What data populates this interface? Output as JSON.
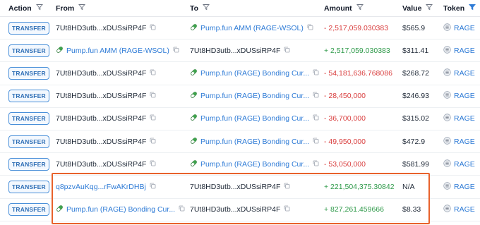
{
  "headers": {
    "action": "Action",
    "from": "From",
    "to": "To",
    "amount": "Amount",
    "value": "Value",
    "token": "Token"
  },
  "rows": [
    {
      "action": "TRANSFER",
      "from": "7Ut8HD3utb...xDUSsiRP4F",
      "from_link": false,
      "from_pill": false,
      "to": "Pump.fun AMM (RAGE-WSOL)",
      "to_link": true,
      "to_pill": true,
      "amount": "- 2,517,059.030383",
      "sign": "neg",
      "value": "$565.9",
      "token": "RAGE"
    },
    {
      "action": "TRANSFER",
      "from": "Pump.fun AMM (RAGE-WSOL)",
      "from_link": true,
      "from_pill": true,
      "to": "7Ut8HD3utb...xDUSsiRP4F",
      "to_link": false,
      "to_pill": false,
      "amount": "+ 2,517,059.030383",
      "sign": "pos",
      "value": "$311.41",
      "token": "RAGE"
    },
    {
      "action": "TRANSFER",
      "from": "7Ut8HD3utb...xDUSsiRP4F",
      "from_link": false,
      "from_pill": false,
      "to": "Pump.fun (RAGE) Bonding Cur...",
      "to_link": true,
      "to_pill": true,
      "amount": "- 54,181,636.768086",
      "sign": "neg",
      "value": "$268.72",
      "token": "RAGE"
    },
    {
      "action": "TRANSFER",
      "from": "7Ut8HD3utb...xDUSsiRP4F",
      "from_link": false,
      "from_pill": false,
      "to": "Pump.fun (RAGE) Bonding Cur...",
      "to_link": true,
      "to_pill": true,
      "amount": "- 28,450,000",
      "sign": "neg",
      "value": "$246.93",
      "token": "RAGE"
    },
    {
      "action": "TRANSFER",
      "from": "7Ut8HD3utb...xDUSsiRP4F",
      "from_link": false,
      "from_pill": false,
      "to": "Pump.fun (RAGE) Bonding Cur...",
      "to_link": true,
      "to_pill": true,
      "amount": "- 36,700,000",
      "sign": "neg",
      "value": "$315.02",
      "token": "RAGE"
    },
    {
      "action": "TRANSFER",
      "from": "7Ut8HD3utb...xDUSsiRP4F",
      "from_link": false,
      "from_pill": false,
      "to": "Pump.fun (RAGE) Bonding Cur...",
      "to_link": true,
      "to_pill": true,
      "amount": "- 49,950,000",
      "sign": "neg",
      "value": "$472.9",
      "token": "RAGE"
    },
    {
      "action": "TRANSFER",
      "from": "7Ut8HD3utb...xDUSsiRP4F",
      "from_link": false,
      "from_pill": false,
      "to": "Pump.fun (RAGE) Bonding Cur...",
      "to_link": true,
      "to_pill": true,
      "amount": "- 53,050,000",
      "sign": "neg",
      "value": "$581.99",
      "token": "RAGE"
    },
    {
      "action": "TRANSFER",
      "from": "q8pzvAuKqg...rFwAKrDHBj",
      "from_link": true,
      "from_pill": false,
      "to": "7Ut8HD3utb...xDUSsiRP4F",
      "to_link": false,
      "to_pill": false,
      "amount": "+ 221,504,375.30842",
      "sign": "pos",
      "value": "N/A",
      "token": "RAGE"
    },
    {
      "action": "TRANSFER",
      "from": "Pump.fun (RAGE) Bonding Cur...",
      "from_link": true,
      "from_pill": true,
      "to": "7Ut8HD3utb...xDUSsiRP4F",
      "to_link": false,
      "to_pill": false,
      "amount": "+ 827,261.459666",
      "sign": "pos",
      "value": "$8.33",
      "token": "RAGE"
    }
  ],
  "colors": {
    "negative": "#d93f3f",
    "positive": "#2f9a4a",
    "link": "#2e7bd6",
    "highlight": "#e8622c"
  },
  "icons": {
    "filter": "funnel-icon",
    "filter_active": "funnel-filled-icon",
    "copy": "copy-icon",
    "program": "pill-icon",
    "token": "coin-icon"
  }
}
